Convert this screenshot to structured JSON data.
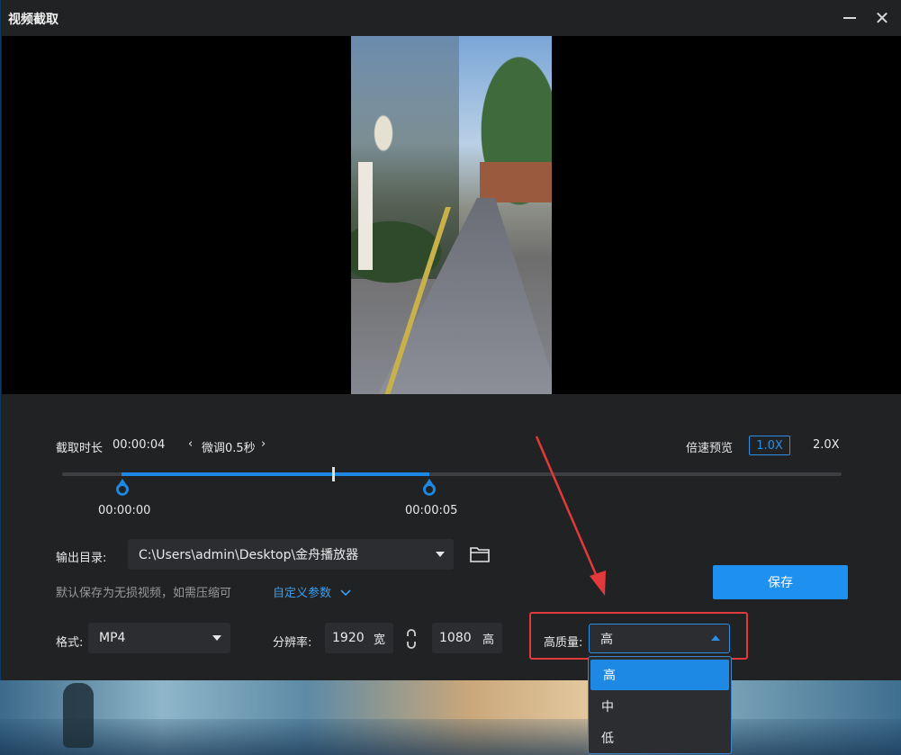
{
  "window": {
    "title": "视频截取"
  },
  "trim": {
    "duration_label": "截取时长",
    "duration_value": "00:00:04",
    "nudge_label": "微调0.5秒",
    "start_time": "00:00:00",
    "end_time": "00:00:05"
  },
  "speed": {
    "label": "倍速预览",
    "options": [
      "1.0X",
      "2.0X"
    ],
    "selected": "1.0X"
  },
  "output": {
    "dir_label": "输出目录:",
    "dir_value": "C:\\Users\\admin\\Desktop\\金舟播放器",
    "hint": "默认保存为无损视频，如需压缩可",
    "custom_link": "自定义参数"
  },
  "save_button": "保存",
  "format": {
    "label": "格式:",
    "value": "MP4"
  },
  "resolution": {
    "label": "分辨率:",
    "width": "1920",
    "width_unit": "宽",
    "height": "1080",
    "height_unit": "高"
  },
  "quality": {
    "label": "高质量:",
    "value": "高",
    "options": [
      "高",
      "中",
      "低"
    ]
  },
  "colors": {
    "accent": "#1e88e5",
    "highlight": "#e23a3a",
    "background": "#202224"
  }
}
